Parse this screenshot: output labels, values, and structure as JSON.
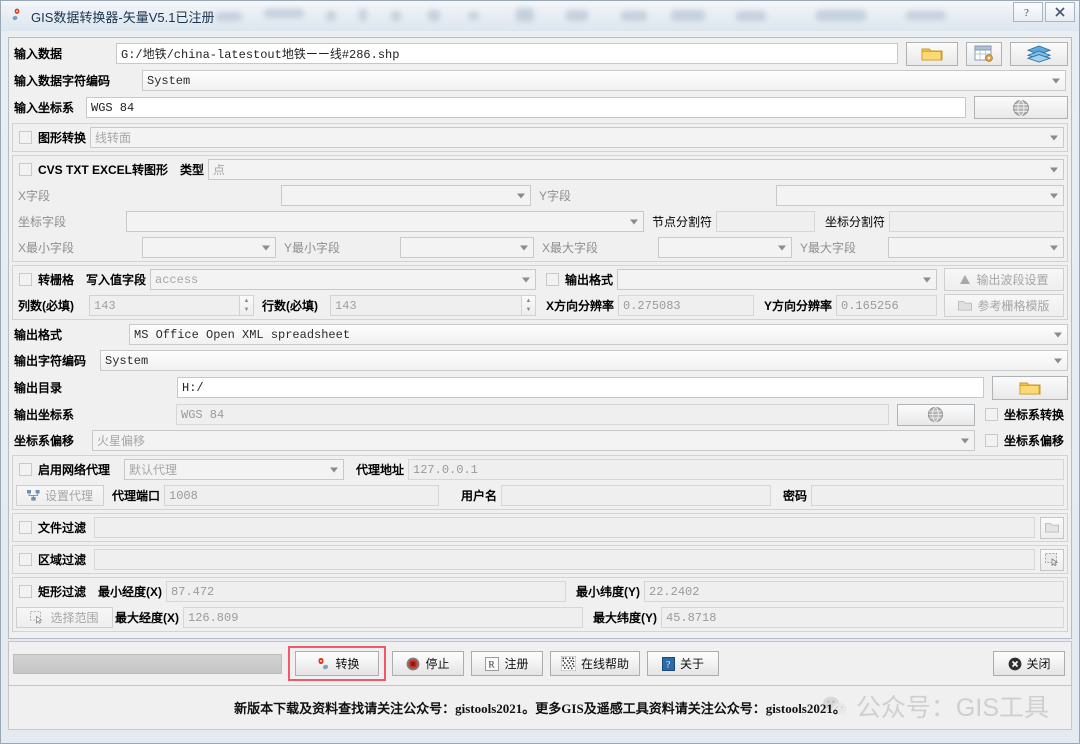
{
  "window": {
    "title": "GIS数据转换器-矢量V5.1已注册",
    "help_button": "?",
    "close_button": "✕"
  },
  "input_section": {
    "input_data_label": "输入数据",
    "input_data_value": "G:/地铁/china-latestout地铁ーー线#286.shp",
    "browse_folder_icon": "folder-icon",
    "browse_table_icon": "table-settings-icon",
    "browse_layers_icon": "layers-icon",
    "input_encoding_label": "输入数据字符编码",
    "input_encoding_value": "System",
    "input_crs_label": "输入坐标系",
    "input_crs_value": "WGS 84",
    "input_crs_button_icon": "globe-icon"
  },
  "shape_convert": {
    "checkbox_label": "图形转换",
    "checked": false,
    "mode_value": "线转面"
  },
  "table_convert": {
    "checkbox_label": "CVS TXT EXCEL转图形",
    "checked": false,
    "type_label": "类型",
    "type_value": "点",
    "x_field_label": "X字段",
    "x_field_value": "",
    "y_field_label": "Y字段",
    "y_field_value": "",
    "coord_field_label": "坐标字段",
    "coord_field_value": "",
    "node_sep_label": "节点分割符",
    "node_sep_value": "",
    "coord_sep_label": "坐标分割符",
    "coord_sep_value": "",
    "xmin_field_label": "X最小字段",
    "xmin_field_value": "",
    "ymin_field_label": "Y最小字段",
    "ymin_field_value": "",
    "xmax_field_label": "X最大字段",
    "xmax_field_value": "",
    "ymax_field_label": "Y最大字段",
    "ymax_field_value": ""
  },
  "raster_convert": {
    "checkbox_label": "转栅格",
    "checked": false,
    "value_field_label": "写入值字段",
    "value_field_value": "access",
    "out_format_label": "输出格式",
    "out_format_value": "",
    "band_settings_button": "输出波段设置",
    "band_settings_icon": "band-icon",
    "cols_label": "列数(必填)",
    "cols_value": "143",
    "rows_label": "行数(必填)",
    "rows_value": "143",
    "xres_label": "X方向分辨率",
    "xres_value": "0.275083",
    "yres_label": "Y方向分辨率",
    "yres_value": "0.165256",
    "template_button": "参考栅格模版",
    "template_icon": "folder-icon"
  },
  "output_section": {
    "out_format_label": "输出格式",
    "out_format_value": "MS Office Open XML spreadsheet",
    "out_encoding_label": "输出字符编码",
    "out_encoding_value": "System",
    "out_dir_label": "输出目录",
    "out_dir_value": "H:/",
    "out_dir_browse_icon": "folder-icon",
    "out_crs_label": "输出坐标系",
    "out_crs_value": "WGS 84",
    "out_crs_button_icon": "globe-icon",
    "crs_transform_label": "坐标系转换",
    "crs_transform_checked": false,
    "crs_offset_label": "坐标系偏移",
    "crs_offset_checked": false,
    "offset_select_label": "坐标系偏移",
    "offset_select_value": "火星偏移"
  },
  "proxy_section": {
    "enable_label": "启用网络代理",
    "enable_checked": false,
    "proxy_type_value": "默认代理",
    "proxy_addr_label": "代理地址",
    "proxy_addr_value": "127.0.0.1",
    "settings_button": "设置代理",
    "settings_icon": "network-icon",
    "port_label": "代理端口",
    "port_value": "1008",
    "user_label": "用户名",
    "user_value": "",
    "password_label": "密码",
    "password_value": ""
  },
  "file_filter": {
    "checkbox_label": "文件过滤",
    "checked": false,
    "value": "",
    "browse_icon": "folder-icon"
  },
  "region_filter": {
    "checkbox_label": "区域过滤",
    "checked": false,
    "value": "",
    "browse_icon": "select-region-icon"
  },
  "rect_filter": {
    "checkbox_label": "矩形过滤",
    "checked": false,
    "select_range_button": "选择范围",
    "select_range_icon": "cursor-select-icon",
    "min_lon_label": "最小经度(X)",
    "min_lon_value": "87.472",
    "max_lon_label": "最大经度(X)",
    "max_lon_value": "126.809",
    "min_lat_label": "最小纬度(Y)",
    "min_lat_value": "22.2402",
    "max_lat_label": "最大纬度(Y)",
    "max_lat_value": "45.8718"
  },
  "action_bar": {
    "progress_value": 0,
    "convert_button": "转换",
    "convert_icon": "gear-flower-icon",
    "stop_button": "停止",
    "stop_icon": "stop-circle-icon",
    "register_button": "注册",
    "register_icon": "register-r-icon",
    "help_button": "在线帮助",
    "help_icon": "qr-code-icon",
    "about_button": "关于",
    "about_icon": "info-icon",
    "close_button": "关闭",
    "close_icon": "close-circle-icon",
    "highlight_color": "#f4566a"
  },
  "footer": {
    "notice": "新版本下载及资料查找请关注公众号：gistools2021。更多GIS及遥感工具资料请关注公众号：gistools2021。",
    "watermark_text": "公众号：GIS工具",
    "watermark_icon": "wechat-icon"
  }
}
